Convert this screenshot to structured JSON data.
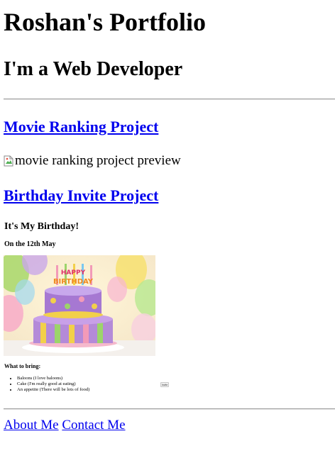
{
  "header": {
    "title": "Roshan's Portfolio",
    "subtitle": "I'm a Web Developer"
  },
  "projects": [
    {
      "link_label": "Movie Ranking Project",
      "preview_alt": "movie ranking project preview"
    },
    {
      "link_label": "Birthday Invite Project",
      "preview": {
        "heading": "It's My Birthday!",
        "date": "On the 12th May",
        "cake_sign": "HAPPY BIRTHDAY",
        "bring_heading": "What to bring:",
        "items": [
          "Baloons (I love baloons)",
          "Cake (I'm really good at eating)",
          "An appetite (There will be lots of food)"
        ],
        "button_label": "Invite"
      }
    }
  ],
  "footer": {
    "about_label": "About Me",
    "contact_label": "Contact Me"
  },
  "colors": {
    "link": "#0000ee"
  }
}
